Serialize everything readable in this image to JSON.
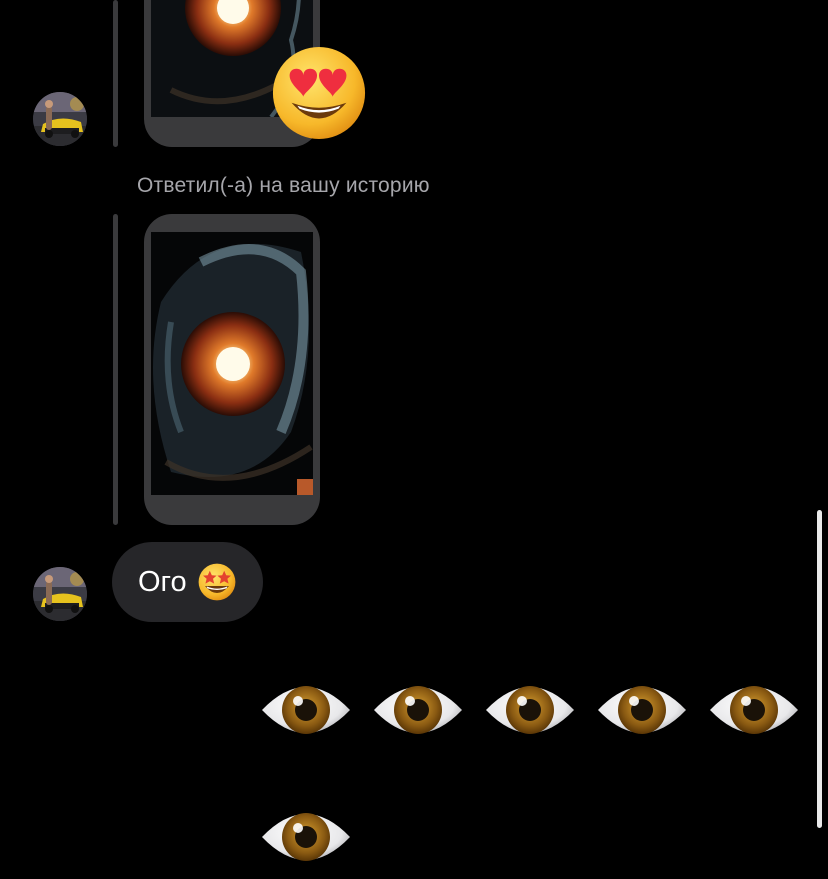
{
  "conversation": {
    "story_reply_label": "Ответил(-а) на вашу историю",
    "message_text": "Ого",
    "message_emoji_icon": "star-struck-emoji-icon",
    "reaction_icon": "heart-eyes-emoji-icon",
    "outgoing_emojis": [
      "eye-emoji-icon",
      "eye-emoji-icon",
      "eye-emoji-icon",
      "eye-emoji-icon",
      "eye-emoji-icon",
      "eye-emoji-icon"
    ]
  },
  "colors": {
    "background": "#000000",
    "incoming_bubble": "#262629",
    "story_frame": "#3a3a3c",
    "secondary_text": "#a6a6ab"
  }
}
